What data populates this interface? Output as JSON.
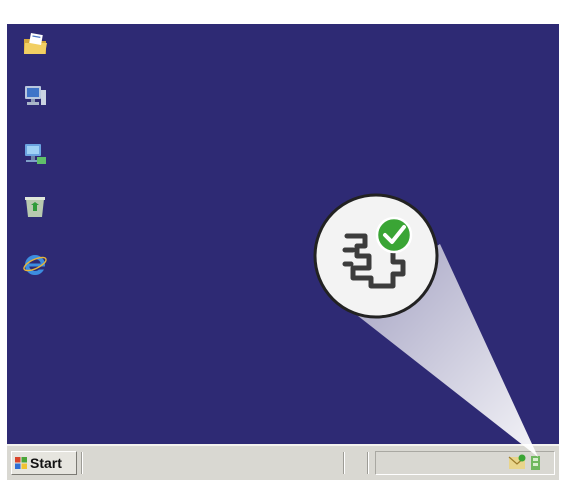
{
  "desktop": {
    "background_color": "#2e2a74",
    "icons": [
      {
        "name": "my-documents-icon"
      },
      {
        "name": "my-computer-icon"
      },
      {
        "name": "network-places-icon"
      },
      {
        "name": "recycle-bin-icon"
      },
      {
        "name": "internet-explorer-icon"
      }
    ]
  },
  "taskbar": {
    "start_label": "Start",
    "tray_icons": [
      {
        "name": "hp-digital-imaging-monitor-icon"
      },
      {
        "name": "tray-status-icon"
      }
    ]
  },
  "callout": {
    "magnified_icon": "hp-digital-imaging-monitor-icon",
    "status": "check-icon",
    "status_color": "#3aa535"
  }
}
